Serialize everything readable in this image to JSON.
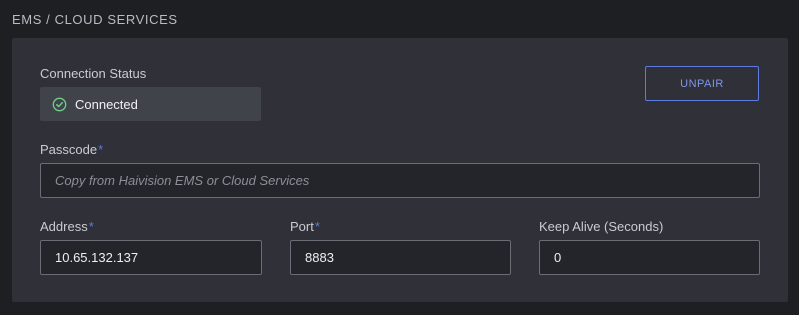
{
  "section": {
    "title": "EMS / CLOUD SERVICES"
  },
  "connection": {
    "label": "Connection Status",
    "status": "Connected",
    "status_icon": "check-circle-icon",
    "status_color": "#6fcf8a"
  },
  "unpair_button": {
    "label": "UNPAIR"
  },
  "passcode": {
    "label": "Passcode",
    "required_mark": "*",
    "value": "",
    "placeholder": "Copy from Haivision EMS or Cloud Services"
  },
  "address": {
    "label": "Address",
    "required_mark": "*",
    "value": "10.65.132.137"
  },
  "port": {
    "label": "Port",
    "required_mark": "*",
    "value": "8883"
  },
  "keep_alive": {
    "label": "Keep Alive (Seconds)",
    "value": "0"
  },
  "colors": {
    "accent": "#5d7be0",
    "panel": "#2f3038",
    "background": "#1e1f23"
  }
}
